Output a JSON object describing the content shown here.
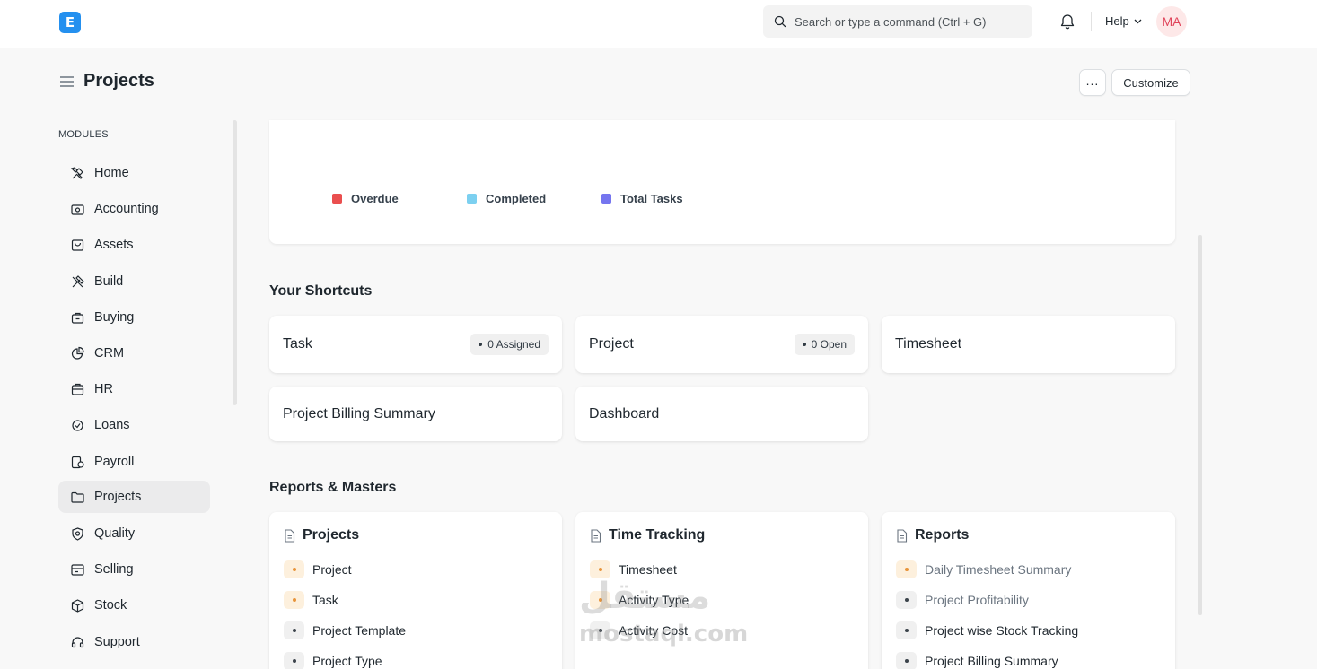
{
  "navbar": {
    "logo_letter": "E",
    "search_placeholder": "Search or type a command (Ctrl + G)",
    "help_label": "Help",
    "avatar_initials": "MA"
  },
  "page": {
    "title": "Projects",
    "more_label": "...",
    "customize_label": "Customize"
  },
  "sidebar": {
    "section_label": "MODULES",
    "items": [
      {
        "label": "Home",
        "icon": "home-icon"
      },
      {
        "label": "Accounting",
        "icon": "accounting-icon"
      },
      {
        "label": "Assets",
        "icon": "assets-icon"
      },
      {
        "label": "Build",
        "icon": "build-icon"
      },
      {
        "label": "Buying",
        "icon": "buying-icon"
      },
      {
        "label": "CRM",
        "icon": "crm-icon"
      },
      {
        "label": "HR",
        "icon": "hr-icon"
      },
      {
        "label": "Loans",
        "icon": "loans-icon"
      },
      {
        "label": "Payroll",
        "icon": "payroll-icon"
      },
      {
        "label": "Projects",
        "icon": "folder-icon",
        "active": true
      },
      {
        "label": "Quality",
        "icon": "quality-icon"
      },
      {
        "label": "Selling",
        "icon": "selling-icon"
      },
      {
        "label": "Stock",
        "icon": "stock-icon"
      },
      {
        "label": "Support",
        "icon": "support-icon"
      }
    ]
  },
  "chart_legend": [
    {
      "label": "Overdue",
      "color": "#ea4f4f"
    },
    {
      "label": "Completed",
      "color": "#7cd0f0"
    },
    {
      "label": "Total Tasks",
      "color": "#7575ef"
    }
  ],
  "shortcuts": {
    "title": "Your Shortcuts",
    "items": [
      {
        "label": "Task",
        "badge": "0 Assigned"
      },
      {
        "label": "Project",
        "badge": "0 Open"
      },
      {
        "label": "Timesheet"
      },
      {
        "label": "Project Billing Summary"
      },
      {
        "label": "Dashboard"
      }
    ]
  },
  "reports": {
    "title": "Reports & Masters",
    "cards": [
      {
        "title": "Projects",
        "links": [
          {
            "label": "Project",
            "color": "orange"
          },
          {
            "label": "Task",
            "color": "orange"
          },
          {
            "label": "Project Template",
            "color": "grey"
          },
          {
            "label": "Project Type",
            "color": "grey"
          }
        ]
      },
      {
        "title": "Time Tracking",
        "links": [
          {
            "label": "Timesheet",
            "color": "orange"
          },
          {
            "label": "Activity Type",
            "color": "orange"
          },
          {
            "label": "Activity Cost",
            "color": "grey"
          }
        ]
      },
      {
        "title": "Reports",
        "links": [
          {
            "label": "Daily Timesheet Summary",
            "color": "orange",
            "muted": true
          },
          {
            "label": "Project Profitability",
            "color": "grey",
            "muted": true
          },
          {
            "label": "Project wise Stock Tracking",
            "color": "grey"
          },
          {
            "label": "Project Billing Summary",
            "color": "grey"
          }
        ]
      }
    ]
  },
  "watermark": {
    "arabic": "مستقل",
    "latin": "mostaql.com"
  }
}
